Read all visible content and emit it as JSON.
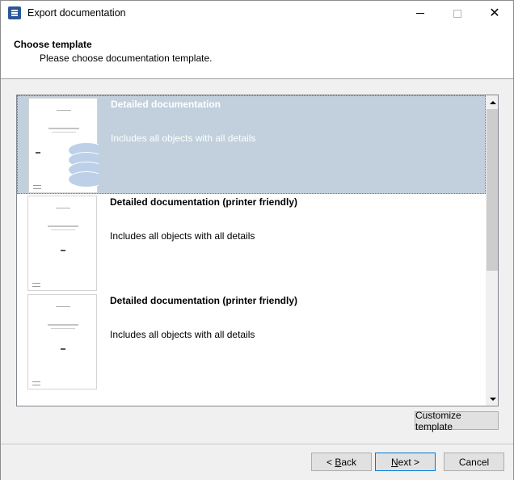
{
  "window": {
    "title": "Export documentation"
  },
  "header": {
    "title": "Choose template",
    "subtitle": "Please choose documentation template."
  },
  "templates": [
    {
      "title": "Detailed documentation",
      "description": "Includes all objects with all details",
      "selected": true
    },
    {
      "title": "Detailed documentation (printer friendly)",
      "description": "Includes all objects with all details",
      "selected": false
    },
    {
      "title": "Detailed documentation (printer friendly)",
      "description": "Includes all objects with all details",
      "selected": false
    }
  ],
  "buttons": {
    "customize": "Customize template",
    "back_prefix": "< ",
    "back_mnemonic": "B",
    "back_rest": "ack",
    "next_mnemonic": "N",
    "next_rest": "ext >",
    "cancel": "Cancel"
  },
  "colors": {
    "selected_row": "#c1d0dc",
    "default_button_border": "#0078d7"
  },
  "icons": {
    "app": "dataedo-app-icon",
    "minimize": "minimize-icon",
    "maximize": "maximize-icon",
    "close": "close-icon"
  }
}
